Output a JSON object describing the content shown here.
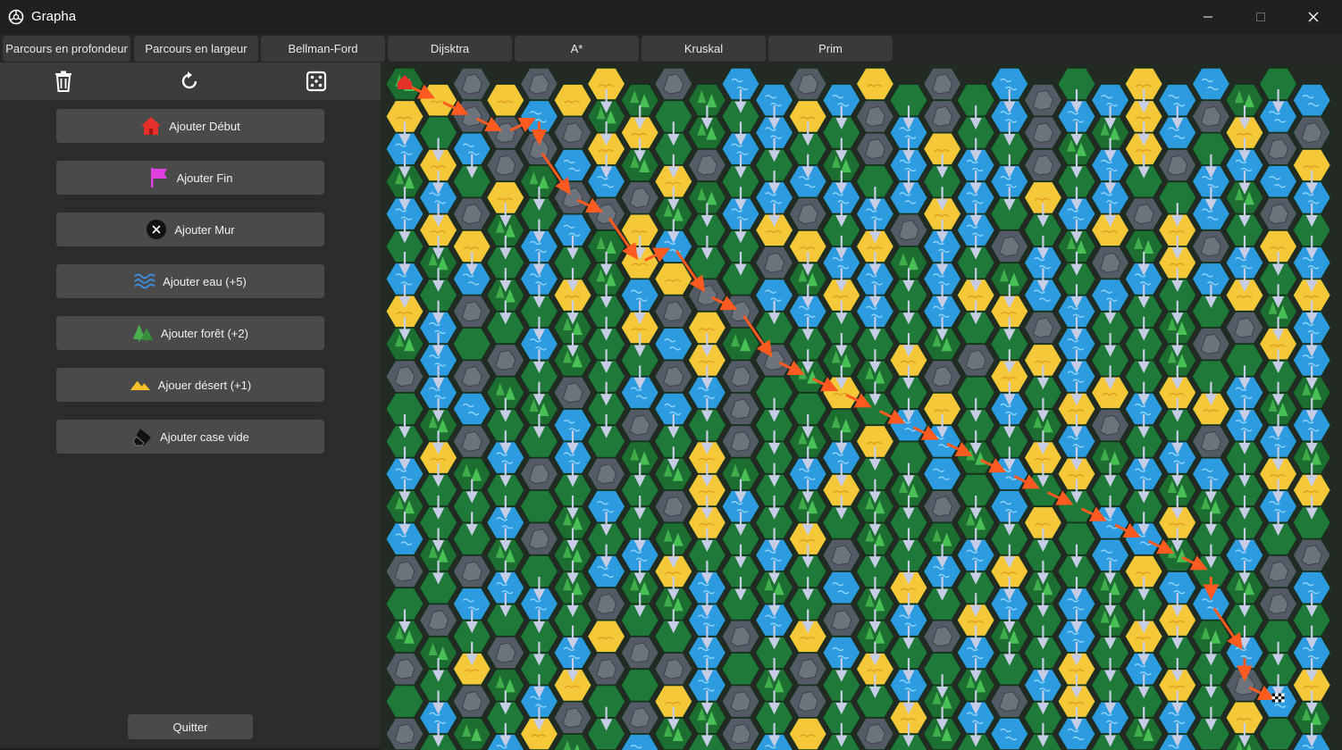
{
  "window": {
    "title": "Grapha"
  },
  "tabs": [
    {
      "label": "Parcours en profondeur"
    },
    {
      "label": "Parcours en largeur"
    },
    {
      "label": "Bellman-Ford"
    },
    {
      "label": "Dijsktra"
    },
    {
      "label": "A*"
    },
    {
      "label": "Kruskal"
    },
    {
      "label": "Prim"
    }
  ],
  "toolbar": {
    "icons": [
      "trash-icon",
      "reset-icon",
      "dice-icon"
    ]
  },
  "actions": [
    {
      "label": "Ajouter Début",
      "icon": "house-icon"
    },
    {
      "label": "Ajouter Fin",
      "icon": "flag-icon"
    },
    {
      "label": "Ajouter Mur",
      "icon": "wall-icon"
    },
    {
      "label": "Ajouter eau (+5)",
      "icon": "water-icon"
    },
    {
      "label": "Ajouter forêt (+2)",
      "icon": "forest-icon"
    },
    {
      "label": "Ajouer désert (+1)",
      "icon": "desert-icon"
    },
    {
      "label": "Ajouter case vide",
      "icon": "eraser-icon"
    }
  ],
  "quit": {
    "label": "Quitter"
  },
  "colors": {
    "grass": "#1f7a3a",
    "water": "#2d9be0",
    "desert": "#f5c83a",
    "rock": "#555b66",
    "forest": "#1d6e31",
    "path_arrow": "#ff5a1f",
    "search_arrow": "#c8cde6"
  },
  "map": {
    "cols": 28,
    "rows": 21,
    "terrain_rows": [
      "fdrdrddfrfwwrwdgrgwrgwdwwfgw",
      "dgrrwrfdgfgwdgrwrgwrwfdwrdwr",
      "wdwrrwdfgrwggfrwdwgrfwdrgwrd",
      "fwgdfrwrdfgwwwgwgwwdgwggwfww",
      "wdrfgwrdfgwdrgwrdwggwdrdwgrg",
      "gfdgwgfdwggrdwdfwgrwfrfdrwdw",
      "wgwfwdfwdrgwfdwgwdfwgwwgwdgd",
      "dwrggfgdrdrgwgwgwgdrwggfgrfw",
      "fwgrwfggwdfrgfgdfrgdwggfrgdw",
      "rwrfgrgwrwrgfdfgrgdgwdgdgwgf",
      "gfwgfwgrwgrggfgwdgwfdrwgdwfw",
      "gdrwgwgfgdrgfwdgwfgdwfgwrgwf",
      "wgfgrgrgfdfgwdgfwgwgdgwfwgdd",
      "fggwgfwgrdwgfgfgrfwdgwgdfgwg",
      "wfgfrfgwfggwdrfgfwgggwwfgwgr",
      "rgrwgfwfdwgfgwgdwgdfgfdwgfrw",
      "grwgwgrgfwgwgrfwgdwgwfgdwgrg",
      "ffgrgwdrgwrgdwfgrwfgwgdgfwgw",
      "rgdfgdrgrwgfrgdwgfgwdgwdgrgd",
      "gwrgwrgrdfrgrggdfwrgdwgwgdwf",
      "rgfwdfgwfgrwdgrgfgwgwgfwgfgw"
    ],
    "path_cells": [
      [
        0,
        0
      ],
      [
        1,
        0
      ],
      [
        2,
        1
      ],
      [
        3,
        1
      ],
      [
        4,
        1
      ],
      [
        4,
        2
      ],
      [
        5,
        3
      ],
      [
        6,
        4
      ],
      [
        7,
        5
      ],
      [
        8,
        5
      ],
      [
        9,
        6
      ],
      [
        10,
        7
      ],
      [
        11,
        8
      ],
      [
        12,
        9
      ],
      [
        13,
        9
      ],
      [
        14,
        10
      ],
      [
        15,
        10
      ],
      [
        16,
        11
      ],
      [
        17,
        11
      ],
      [
        18,
        12
      ],
      [
        19,
        12
      ],
      [
        20,
        13
      ],
      [
        21,
        13
      ],
      [
        22,
        14
      ],
      [
        23,
        14
      ],
      [
        24,
        15
      ],
      [
        24,
        16
      ],
      [
        25,
        17
      ],
      [
        25,
        18
      ],
      [
        26,
        19
      ]
    ],
    "start": [
      0,
      0
    ],
    "end": [
      26,
      19
    ]
  }
}
